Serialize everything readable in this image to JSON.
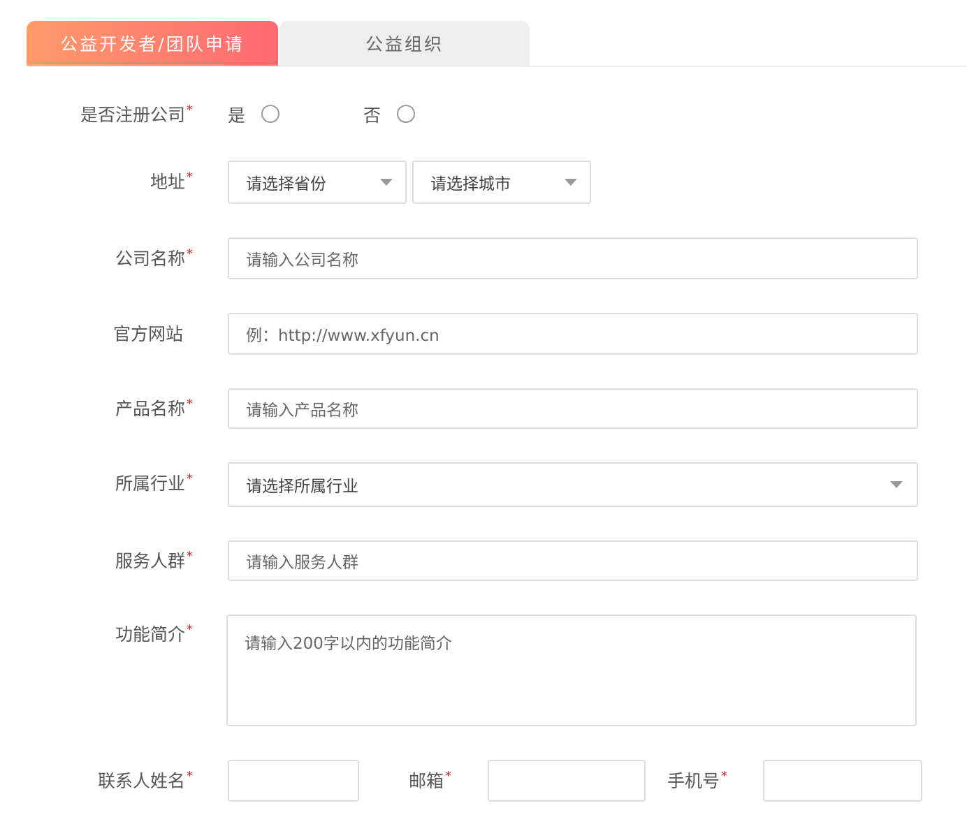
{
  "tabs": [
    {
      "label": "公益开发者/团队申请",
      "active": true
    },
    {
      "label": "公益组织",
      "active": false
    }
  ],
  "required_mark": "*",
  "form": {
    "registered": {
      "label": "是否注册公司",
      "options": [
        "是",
        "否"
      ]
    },
    "address": {
      "label": "地址",
      "province_placeholder": "请选择省份",
      "city_placeholder": "请选择城市"
    },
    "company_name": {
      "label": "公司名称",
      "placeholder": "请输入公司名称"
    },
    "website": {
      "label": "官方网站",
      "placeholder": "例：http://www.xfyun.cn"
    },
    "product_name": {
      "label": "产品名称",
      "placeholder": "请输入产品名称"
    },
    "industry": {
      "label": "所属行业",
      "placeholder": "请选择所属行业"
    },
    "audience": {
      "label": "服务人群",
      "placeholder": "请输入服务人群"
    },
    "intro": {
      "label": "功能简介",
      "placeholder": "请输入200字以内的功能简介"
    },
    "contact_name": {
      "label": "联系人姓名",
      "value": ""
    },
    "email": {
      "label": "邮箱",
      "value": ""
    },
    "phone": {
      "label": "手机号",
      "value": ""
    }
  },
  "colors": {
    "tab_gradient_start": "#ff9a6a",
    "tab_gradient_end": "#ff6a72",
    "required": "#e02020",
    "border": "#dcdcdc"
  }
}
